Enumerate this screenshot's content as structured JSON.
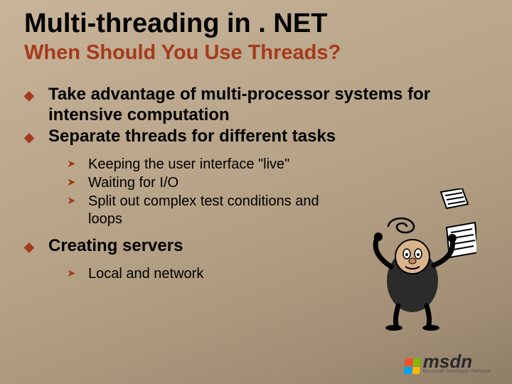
{
  "title": "Multi-threading in . NET",
  "subtitle": "When Should You Use Threads?",
  "bullets": {
    "b1": "Take advantage of multi-processor systems for intensive computation",
    "b2": "Separate threads for different tasks",
    "b2_sub": {
      "s1": "Keeping the user interface \"live\"",
      "s2": "Waiting for I/O",
      "s3": "Split out complex test conditions and loops"
    },
    "b3": "Creating servers",
    "b3_sub": {
      "s1": "Local and network"
    }
  },
  "logo": {
    "brand": "msdn",
    "tagline": "Microsoft Developer Network"
  },
  "icons": {
    "diamond": "◆",
    "chevron": "➤"
  }
}
